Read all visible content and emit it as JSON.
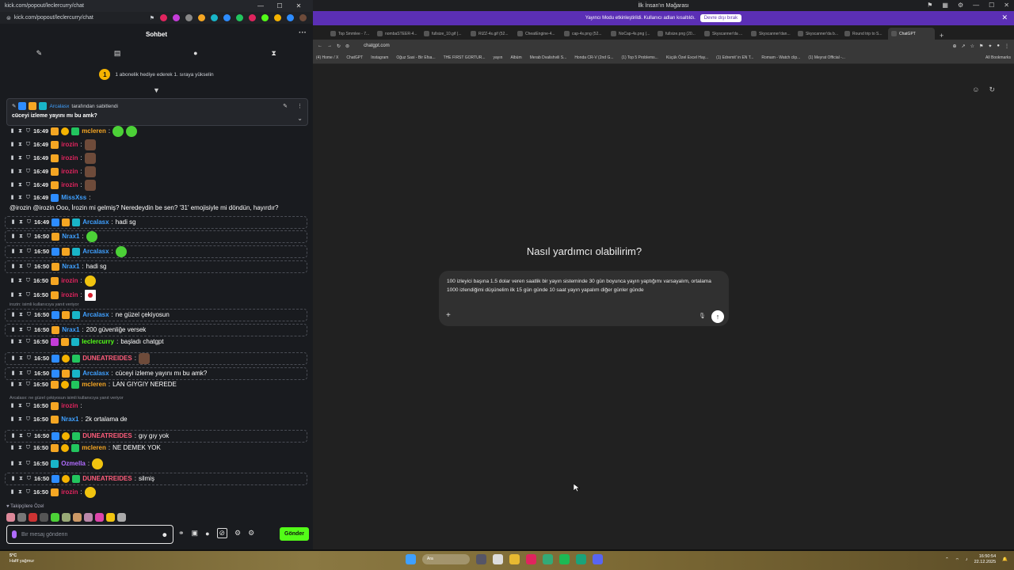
{
  "kick_window": {
    "title_url": "kick.com/popout/leclercurry/chat",
    "address_url": "kick.com/popout/leclercurry/chat",
    "chat_title": "Sohbet",
    "more_icon": "more-icon",
    "tabs": [
      "pin-icon",
      "list-icon",
      "chat-icon",
      "hourglass-icon"
    ],
    "sub_banner": {
      "badge": "1",
      "text": "1 abonelik hediye ederek 1. sıraya yükselin"
    },
    "pinned": {
      "user": "Arcalasx",
      "by_text": "tarafından sabitlendi",
      "message": "cüceyi izleme yayını mı bu amk?"
    },
    "messages": [
      {
        "time": "16:49",
        "user": "mcleren",
        "color": "#f5a623",
        "text": "",
        "emotes": [
          "green",
          "green"
        ]
      },
      {
        "time": "16:49",
        "user": "irozin",
        "color": "#e0245e",
        "text": "",
        "emotes": [
          "brown"
        ]
      },
      {
        "time": "16:49",
        "user": "irozin",
        "color": "#e0245e",
        "text": "",
        "emotes": [
          "brown"
        ]
      },
      {
        "time": "16:49",
        "user": "irozin",
        "color": "#e0245e",
        "text": "",
        "emotes": [
          "brown"
        ]
      },
      {
        "time": "16:49",
        "user": "irozin",
        "color": "#e0245e",
        "text": "",
        "emotes": [
          "brown"
        ]
      },
      {
        "time": "16:49",
        "user": "MissXss",
        "color": "#3fa0ff",
        "text": "@irozin @irozin Ooo, İrozin mi gelmiş? Neredeydin be sen? '31' emojisiyle mi döndün, hayırdır?"
      },
      {
        "time": "16:49",
        "user": "Arcalasx",
        "color": "#3fa0ff",
        "text": "hadi sg"
      },
      {
        "time": "16:50",
        "user": "Nrax1",
        "color": "#3fa0ff",
        "text": "",
        "emotes": [
          "green"
        ]
      },
      {
        "time": "16:50",
        "user": "Arcalasx",
        "color": "#3fa0ff",
        "text": "",
        "emotes": [
          "green"
        ]
      },
      {
        "time": "16:50",
        "user": "Nrax1",
        "color": "#3fa0ff",
        "text": "hadi sg"
      },
      {
        "time": "16:50",
        "user": "irozin",
        "color": "#e0245e",
        "text": "",
        "emotes": [
          "yellow"
        ]
      },
      {
        "time": "16:50",
        "user": "irozin",
        "color": "#e0245e",
        "text": "",
        "emotes": [
          "flag"
        ]
      },
      {
        "time": "16:50",
        "user": "Arcalasx",
        "color": "#3fa0ff",
        "text": "ne güzel çekiyosun"
      },
      {
        "time": "16:50",
        "user": "Nrax1",
        "color": "#3fa0ff",
        "text": "200 güvenliğe versek"
      },
      {
        "time": "16:50",
        "user": "leclercurry",
        "color": "#53fc18",
        "text": "başladı chatgpt"
      },
      {
        "time": "16:50",
        "user": "DUNEATREIDES",
        "color": "#ff5c7a",
        "text": "",
        "emotes": [
          "brown"
        ]
      },
      {
        "time": "16:50",
        "user": "Arcalasx",
        "color": "#3fa0ff",
        "text": "cüceyi izleme yayını mı bu amk?"
      },
      {
        "time": "16:50",
        "user": "mcleren",
        "color": "#f5a623",
        "text": "LAN GIYGIY NEREDE"
      },
      {
        "time": "16:50",
        "user": "irozin",
        "color": "#e0245e",
        "text": ""
      },
      {
        "time": "16:50",
        "user": "Nrax1",
        "color": "#3fa0ff",
        "text": "2k ortalama de"
      },
      {
        "time": "16:50",
        "user": "DUNEATREIDES",
        "color": "#ff5c7a",
        "text": "gıy gıy yok"
      },
      {
        "time": "16:50",
        "user": "mcleren",
        "color": "#f5a623",
        "text": "NE DEMEK YOK"
      },
      {
        "time": "16:50",
        "user": "Ozmella",
        "color": "#b06cff",
        "text": "",
        "emotes": [
          "yellow"
        ]
      },
      {
        "time": "16:50",
        "user": "DUNEATREIDES",
        "color": "#ff5c7a",
        "text": "silmiş"
      },
      {
        "time": "16:50",
        "user": "irozin",
        "color": "#e0245e",
        "text": "",
        "emotes": [
          "yellow"
        ]
      }
    ],
    "reply_notes": [
      "irozin: isimli kullanıcıya yanıt veriyor",
      "Arcalasx: ne güzel çekiyosun isimli kullanıcıya yanıt veriyor"
    ],
    "followers_label": "Takipçilere Özel",
    "input_placeholder": "Bir mesaj gönderin",
    "send_label": "Gönder"
  },
  "browser": {
    "window_title": "İlk İnsan'ın Mağarası",
    "notification": {
      "text": "Yayıncı Modu etkinleştirildi. Kullanıcı adları kısaltıldı.",
      "button": "Devre dışı bırak"
    },
    "tabs": [
      "Top Smmlee - 7...",
      "nombaSTEER-4...",
      "fullsize_10.gif (...",
      "RIZZ-4s.gif (52...",
      "CheatEngine-4...",
      "cap-4s.png (52...",
      "NoCap-4s.png (...",
      "fullsize.png (20...",
      "Skyscanner'da ...",
      "Skyscanner'dan...",
      "Skyscanner'da b...",
      "Round trip to S...",
      "ChatGPT"
    ],
    "url": "chatgpt.com",
    "bookmarks": [
      "(4) Home / X",
      "ChatGPT",
      "Instagram",
      "Oğuz Sasi - Bir Efsa...",
      "THE FIRST GORTUR...",
      "yayın",
      "Albüm",
      "Merab Dvalishvili S...",
      "Honda CR-V (2nd G...",
      "(1) Top 5 Problems...",
      "Küçük Özel Excel Hay...",
      "(1) Edremit' in EN T...",
      "Romam - Watch clip...",
      "(1) Meyrat Official -..."
    ],
    "all_bookmarks": "All Bookmarks",
    "chatgpt": {
      "heading": "Nasıl yardımcı olabilirim?",
      "prompt": "100 izleyici başına 1.5 dolar veren saatlik bir yayın sisteminde 30 gün boyunca yayın yaptığımı varsayalım, ortalama 1000 izlendiğimi düşünelim ilk 15 gün günde 10 saat yayın yapalım diğer günler günde"
    }
  },
  "taskbar": {
    "weather_temp": "5°C",
    "weather_desc": "Hafif yağmur",
    "search_placeholder": "Ara",
    "time": "16:50:54",
    "date": "22.12.2025"
  }
}
